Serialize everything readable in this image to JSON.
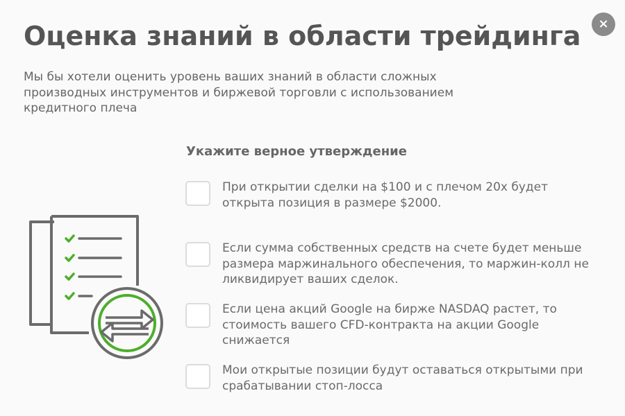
{
  "modal": {
    "close_symbol": "×",
    "title": "Оценка знаний в области трейдинга",
    "intro": "Мы бы хотели оценить уровень ваших знаний в области сложных производных инструментов и биржевой торговли с использованием кредитного плеча",
    "question": "Укажите верное утверждение",
    "options": [
      {
        "text": "При открытии сделки на $100 и с плечом 20x будет открыта позиция в размере $2000.",
        "checked": false
      },
      {
        "text": "Если сумма собственных средств на счете будет меньше размера маржинального обеспечения, то маржин-колл не ликвидирует ваших сделок.",
        "checked": false
      },
      {
        "text": "Если цена акций Google на бирже NASDAQ растет, то стоимость вашего CFD-контракта на акции Google снижается",
        "checked": false
      },
      {
        "text": "Мои открытые позиции будут оставаться открытыми при срабатывании стоп-лосса",
        "checked": false
      }
    ],
    "illustration_icon": "checklist-exchange-icon"
  },
  "colors": {
    "background": "#fafafa",
    "title": "#555555",
    "text": "#666666",
    "close_button": "#8b8b8b",
    "checkbox_border": "#dcdcdc",
    "accent_green": "#4caf2a",
    "icon_gray": "#6b6b6b"
  }
}
